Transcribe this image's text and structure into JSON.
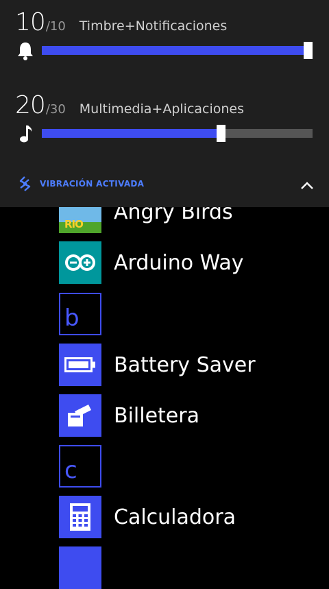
{
  "volume_panel": {
    "ringer": {
      "level": "10",
      "max": "/10",
      "label": "Timbre+Notificaciones",
      "value": 10,
      "maximum": 10,
      "icon": "bell-icon"
    },
    "media": {
      "level": "20",
      "max": "/30",
      "label": "Multimedia+Aplicaciones",
      "value": 20,
      "maximum": 30,
      "icon": "music-note-icon"
    },
    "vibration": {
      "label": "VIBRACIÓN ACTIVADA",
      "icon": "vibration-icon"
    },
    "collapse_icon": "chevron-up-icon"
  },
  "app_list": [
    {
      "name": "Angry Birds",
      "tile": "image",
      "icon": "angry-birds-rio-icon"
    },
    {
      "name": "Arduino Way",
      "tile": "teal",
      "icon": "arduino-infinity-icon"
    },
    {
      "letter": "b"
    },
    {
      "name": "Battery Saver",
      "tile": "blue",
      "icon": "battery-icon"
    },
    {
      "name": "Billetera",
      "tile": "blue",
      "icon": "wallet-icon"
    },
    {
      "letter": "c"
    },
    {
      "name": "Calculadora",
      "tile": "blue",
      "icon": "calculator-icon"
    }
  ],
  "colors": {
    "accent": "#3e4cf0",
    "panel_background": "#1f1f1f",
    "track": "#555555",
    "vibration_text": "#4d7dff",
    "arduino_teal": "#00979c"
  }
}
